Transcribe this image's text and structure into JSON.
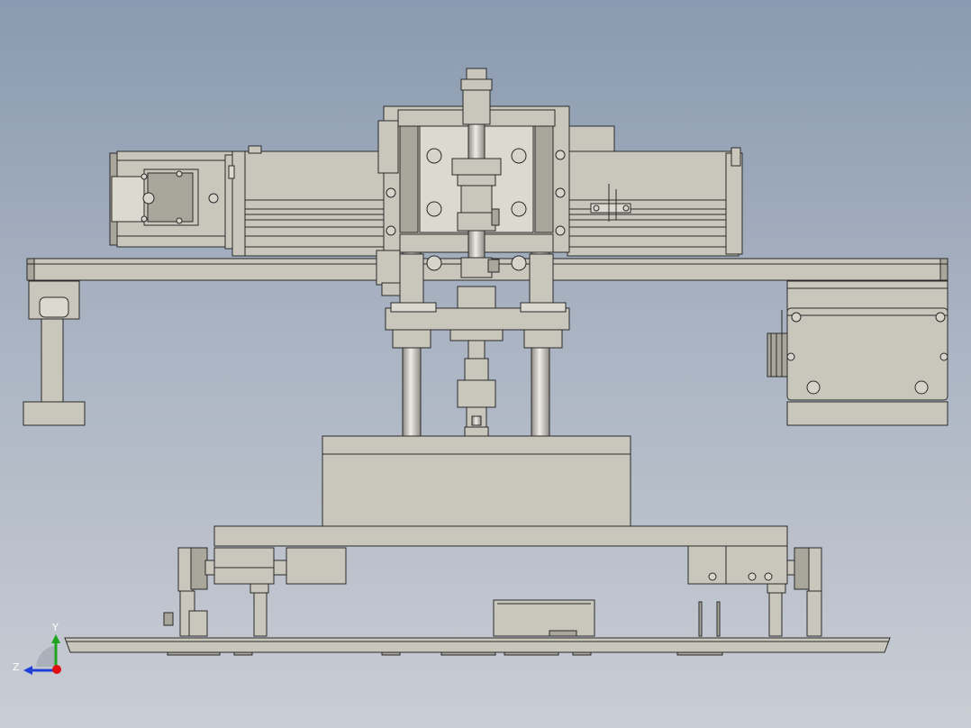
{
  "view": {
    "background_top": "#8a9ab0",
    "background_bottom": "#c9cdd4",
    "part_color": "#c9c6bc",
    "edge_color": "#2a2a2a"
  },
  "triad": {
    "y_label": "Y",
    "z_label": "Z",
    "y_color": "#1fa31f",
    "z_color": "#1f3fd6",
    "origin_color": "#e01010"
  }
}
